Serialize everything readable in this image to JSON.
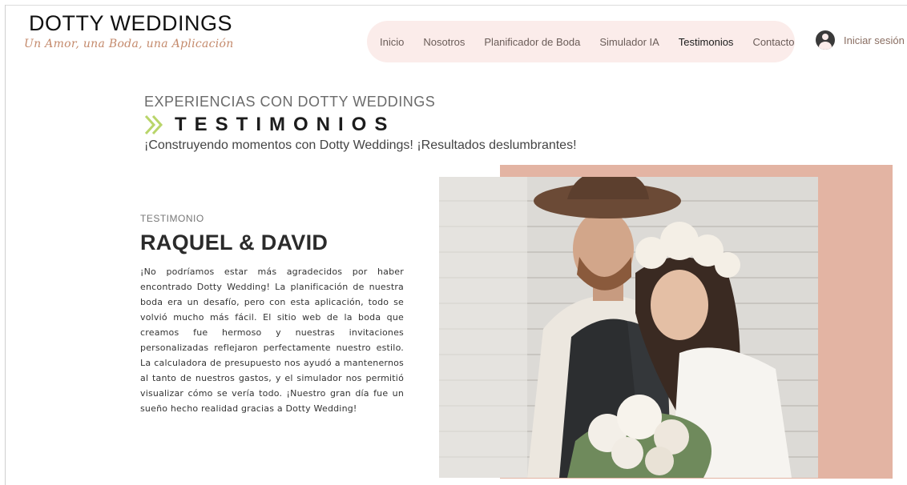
{
  "brand": {
    "title": "DOTTY WEDDINGS",
    "tagline": "Un Amor, una Boda, una Aplicación"
  },
  "nav": {
    "items": [
      {
        "label": "Inicio"
      },
      {
        "label": "Nosotros"
      },
      {
        "label": "Planificador de Boda"
      },
      {
        "label": "Simulador IA"
      },
      {
        "label": "Testimonios",
        "active": true
      },
      {
        "label": "Contacto"
      }
    ],
    "login_label": "Iniciar sesión"
  },
  "hero": {
    "eyebrow": "EXPERIENCIAS CON DOTTY WEDDINGS",
    "heading": "TESTIMONIOS",
    "subheading": "¡Construyendo momentos con Dotty Weddings! ¡Resultados deslumbrantes!"
  },
  "testimonial": {
    "label": "TESTIMONIO",
    "couple": "RAQUEL & DAVID",
    "text": "¡No podríamos estar más agradecidos por haber encontrado Dotty Wedding! La planificación de nuestra boda era un desafío, pero con esta aplicación, todo se volvió mucho más fácil. El sitio web de la boda que creamos fue hermoso y nuestras invitaciones personalizadas reflejaron perfectamente nuestro estilo. La calculadora de presupuesto nos ayudó a mantenernos al tanto de nuestros gastos, y el simulador nos permitió visualizar cómo se vería todo. ¡Nuestro gran día fue un sueño hecho realidad gracias a Dotty Wedding!"
  },
  "colors": {
    "nav_bg": "#fbecea",
    "accent_block": "#e3b4a3",
    "chevron": "#b9d56a",
    "tagline": "#c48a6c"
  },
  "icons": {
    "login": "user-avatar-icon",
    "heading": "double-chevron-right-icon"
  }
}
